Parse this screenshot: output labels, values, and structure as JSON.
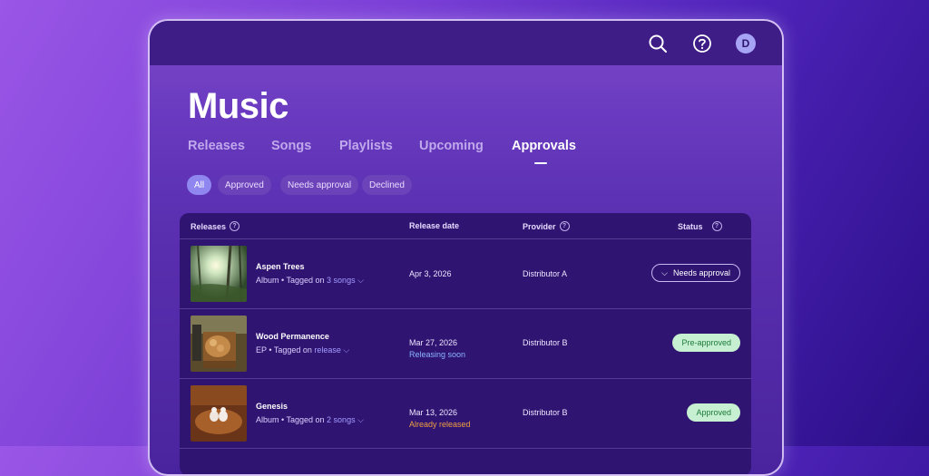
{
  "header": {
    "avatar_initial": "D",
    "icons": [
      "search-icon",
      "help-icon"
    ]
  },
  "page": {
    "title": "Music"
  },
  "tabs": [
    {
      "label": "Releases",
      "active": false
    },
    {
      "label": "Songs",
      "active": false
    },
    {
      "label": "Playlists",
      "active": false
    },
    {
      "label": "Upcoming",
      "active": false
    },
    {
      "label": "Approvals",
      "active": true
    }
  ],
  "filters": [
    {
      "label": "All",
      "active": true
    },
    {
      "label": "Approved",
      "active": false
    },
    {
      "label": "Needs approval",
      "active": false
    },
    {
      "label": "Declined",
      "active": false
    }
  ],
  "table": {
    "columns": {
      "releases": "Releases",
      "release_date": "Release date",
      "provider": "Provider",
      "status": "Status"
    },
    "rows": [
      {
        "title": "Aspen Trees",
        "type": "Album",
        "tagged_prefix": " • Tagged on ",
        "tagged_link": "3 songs",
        "date": "Apr 3, 2026",
        "date_note": "",
        "provider": "Distributor A",
        "status": "Needs approval"
      },
      {
        "title": "Wood Permanence",
        "type": "EP",
        "tagged_prefix": " • Tagged on ",
        "tagged_link": "release",
        "date": "Mar 27, 2026",
        "date_note": "Releasing soon",
        "provider": "Distributor B",
        "status": "Pre-approved"
      },
      {
        "title": "Genesis",
        "type": "Album",
        "tagged_prefix": " • Tagged on ",
        "tagged_link": "2 songs",
        "date": "Mar 13, 2026",
        "date_note": "Already released",
        "provider": "Distributor B",
        "status": "Approved"
      }
    ]
  },
  "colors": {
    "accent": "#8f86f0",
    "link": "#a59dff",
    "releasing_soon": "#8ab4ff",
    "already_released": "#f0a040",
    "approved_bg": "#c6f0d1",
    "approved_text": "#1d7a3a"
  }
}
